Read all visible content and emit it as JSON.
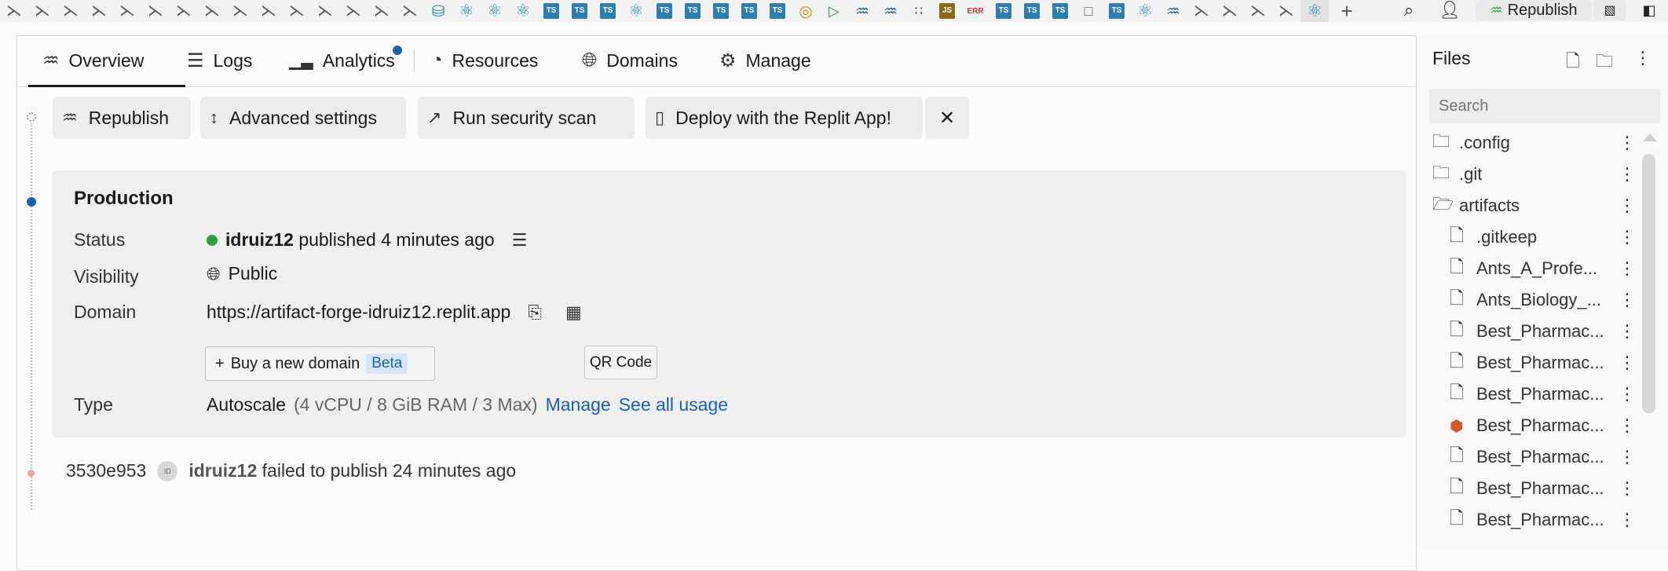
{
  "topbar": {
    "tab_icons": [
      "close",
      "close",
      "close",
      "close",
      "close",
      "close",
      "close",
      "close",
      "close",
      "close",
      "close",
      "close",
      "close",
      "close",
      "close",
      "db",
      "react",
      "react",
      "react",
      "ts",
      "ts",
      "ts",
      "react",
      "ts",
      "ts",
      "ts",
      "ts",
      "ts",
      "ring",
      "play",
      "shell",
      "shell",
      "git",
      "js",
      "red",
      "ts",
      "ts",
      "ts",
      "doc",
      "ts",
      "react",
      "shell",
      "close",
      "close",
      "close",
      "close",
      "react"
    ],
    "ts_label": "TS",
    "js_label": "JS",
    "red_label": "ERR",
    "republish_label": "Republish"
  },
  "tabs": {
    "overview": "Overview",
    "logs": "Logs",
    "analytics": "Analytics",
    "resources": "Resources",
    "domains": "Domains",
    "manage": "Manage"
  },
  "actions": {
    "republish": "Republish",
    "advanced": "Advanced settings",
    "scan": "Run security scan",
    "deploy": "Deploy with the Replit App!"
  },
  "production": {
    "title": "Production",
    "status_label": "Status",
    "status_user": "idruiz12",
    "status_text": "published 4 minutes ago",
    "visibility_label": "Visibility",
    "visibility_value": "Public",
    "domain_label": "Domain",
    "domain_value": "https://artifact-forge-idruiz12.replit.app",
    "buy_domain": "Buy a new domain",
    "beta": "Beta",
    "qr_tooltip": "QR Code",
    "type_label": "Type",
    "type_value": "Autoscale",
    "type_specs": "(4 vCPU / 8 GiB RAM / 3 Max)",
    "manage_link": "Manage",
    "usage_link": "See all usage"
  },
  "history": {
    "commit": "3530e953",
    "avatar_initials": "ID",
    "user": "idruiz12",
    "text": "failed to publish 24 minutes ago"
  },
  "files": {
    "title": "Files",
    "search_placeholder": "Search",
    "items": [
      {
        "name": ".config",
        "type": "folder",
        "indent": 0
      },
      {
        "name": ".git",
        "type": "folder",
        "indent": 0
      },
      {
        "name": "artifacts",
        "type": "folder-open",
        "indent": 0
      },
      {
        "name": ".gitkeep",
        "type": "file",
        "indent": 1
      },
      {
        "name": "Ants_A_Profe...",
        "type": "file",
        "indent": 1
      },
      {
        "name": "Ants_Biology_...",
        "type": "file",
        "indent": 1
      },
      {
        "name": "Best_Pharmac...",
        "type": "file",
        "indent": 1
      },
      {
        "name": "Best_Pharmac...",
        "type": "file",
        "indent": 1
      },
      {
        "name": "Best_Pharmac...",
        "type": "file",
        "indent": 1
      },
      {
        "name": "Best_Pharmac...",
        "type": "html",
        "indent": 1
      },
      {
        "name": "Best_Pharmac...",
        "type": "file",
        "indent": 1
      },
      {
        "name": "Best_Pharmac...",
        "type": "file",
        "indent": 1
      },
      {
        "name": "Best_Pharmac...",
        "type": "file",
        "indent": 1
      }
    ]
  }
}
